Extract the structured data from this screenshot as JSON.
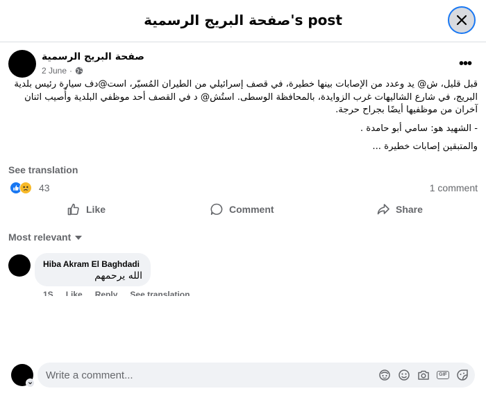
{
  "dialog": {
    "title": "صفحة البريج الرسمية's post",
    "close_icon": "close-icon"
  },
  "post": {
    "author": "صفحة البريج الرسمية",
    "date": "2 June",
    "date_separator": "·",
    "privacy_icon": "globe-icon",
    "more_icon": "more-horizontal-icon",
    "more_label": "•••",
    "body": [
      "قبل قليل، ش@ يد وعدد من الإصابات بينها خطيرة، في قصف إسرائيلي من الطيران المُسيّر، است@دف سيارة رئيس بلدية البريج، في شارع الشاليهات غرب الزوايدة، بالمحافظة الوسطى. استُش@ د في القصف أحد موظفي البلدية وأُصيب اثنان آخران من موظفيها أيضًا بجراح حرجة.",
      "- الشهيد هو: سامي أبو حامدة .",
      "والمتبقين إصابات خطيرة ..."
    ],
    "see_translation": "See translation",
    "reaction_count": "43",
    "reaction_icons": [
      "like-reaction-icon",
      "sad-reaction-icon"
    ],
    "comment_count": "1 comment"
  },
  "actions": {
    "like": "Like",
    "comment": "Comment",
    "share": "Share"
  },
  "comments": {
    "sort_label": "Most relevant",
    "items": [
      {
        "author": "Hiba Akram El Baghdadi",
        "text": "الله يرحمهم",
        "time": "1S",
        "like": "Like",
        "reply": "Reply",
        "see_translation": "See translation"
      }
    ]
  },
  "composer": {
    "placeholder": "Write a comment...",
    "tools": [
      "avatar-sticker-icon",
      "emoji-icon",
      "camera-icon",
      "gif-icon",
      "sticker-icon"
    ],
    "gif_label": "GIF"
  },
  "colors": {
    "accent": "#1877f2",
    "secondary_text": "#65676b",
    "bubble": "#f0f2f5",
    "sad_reaction": "#f7b928"
  }
}
